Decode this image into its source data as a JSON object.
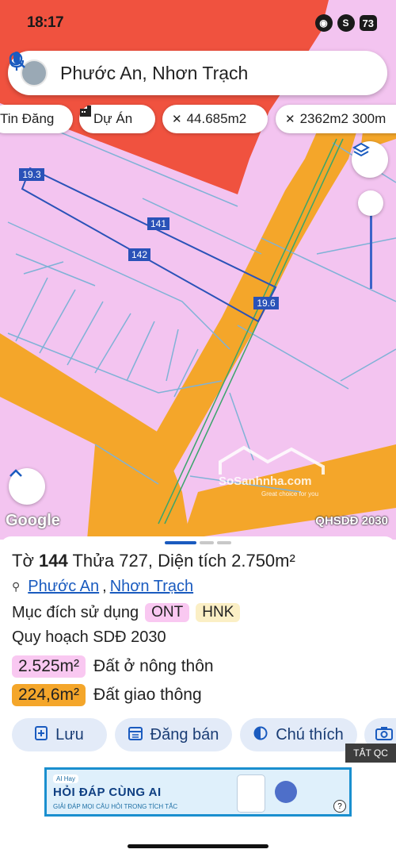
{
  "status_bar": {
    "time": "18:17",
    "battery": "73"
  },
  "search": {
    "text": "Phước An, Nhơn Trạch"
  },
  "chips": [
    {
      "label": "Tin Đăng",
      "icon": ""
    },
    {
      "label": "Dự Án",
      "icon": "building-icon"
    },
    {
      "label": "44.685m2",
      "icon": "ruler-icon"
    },
    {
      "label": "2362m2 300m",
      "icon": "ruler-icon"
    }
  ],
  "map": {
    "parcel_labels": {
      "top_width": "19.3",
      "side_a": "141",
      "side_b": "142",
      "bottom_width": "19.6"
    },
    "google_label": "Google",
    "layer_label": "QHSDĐ 2030",
    "watermark_title": "SoSanhnha.com",
    "watermark_slogan": "Great choice for you",
    "colors": {
      "residential": "#f3c4f0",
      "road": "#f4a62a",
      "red_zone": "#f0523f",
      "parcel_outline": "#2a52b8"
    }
  },
  "sheet": {
    "title_prefix": "Tờ",
    "sheet_no": "144",
    "plot_prefix": "Thửa",
    "plot_no": "727,",
    "area_label": "Diện tích",
    "area_value": "2.750m²",
    "ward": "Phước An",
    "district": "Nhơn Trạch",
    "purpose_label": "Mục đích sử dụng",
    "purpose_tags": [
      "ONT",
      "HNK"
    ],
    "plan_label": "Quy hoạch SDĐ 2030",
    "areas": [
      {
        "value": "2.525m²",
        "desc": "Đất ở nông thôn",
        "color": "#f9c8f1"
      },
      {
        "value": "224,6m²",
        "desc": "Đất giao thông",
        "color": "#f4a62a"
      }
    ]
  },
  "actions": [
    {
      "label": "Lưu",
      "icon": "add-document-icon"
    },
    {
      "label": "Đăng bán",
      "icon": "calendar-icon"
    },
    {
      "label": "Chú thích",
      "icon": "contrast-icon"
    },
    {
      "label": "",
      "icon": "camera-icon"
    }
  ],
  "ad": {
    "brand": "AI Hay",
    "headline": "HỎI ĐÁP CÙNG AI",
    "subline": "GIẢI ĐÁP MỌI CÂU HỎI TRONG TÍCH TẮC",
    "close_label": "TẮT QC",
    "help": "?"
  }
}
